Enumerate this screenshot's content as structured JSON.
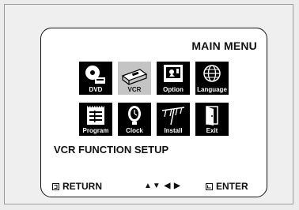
{
  "menu": {
    "title": "MAIN MENU",
    "subtitle": "VCR FUNCTION SETUP",
    "items": [
      {
        "label": "DVD",
        "icon": "dvd-icon",
        "selected": false
      },
      {
        "label": "VCR",
        "icon": "vcr-icon",
        "selected": true
      },
      {
        "label": "Option",
        "icon": "option-icon",
        "selected": false
      },
      {
        "label": "Language",
        "icon": "globe-icon",
        "selected": false
      },
      {
        "label": "Program",
        "icon": "program-icon",
        "selected": false
      },
      {
        "label": "Clock",
        "icon": "clock-icon",
        "selected": false
      },
      {
        "label": "Install",
        "icon": "antenna-icon",
        "selected": false
      },
      {
        "label": "Exit",
        "icon": "exit-door-icon",
        "selected": false
      }
    ]
  },
  "footer": {
    "return_label": "RETURN",
    "arrows": "▲▼ ◀ ▶",
    "enter_label": "ENTER"
  }
}
